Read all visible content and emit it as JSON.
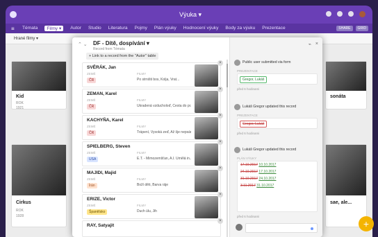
{
  "topbar": {
    "title": "Výuka ▾"
  },
  "navbar": {
    "menu_icon": "menu-icon",
    "tabs": [
      "Témata",
      "Filmy ▾",
      "Autor",
      "Studio",
      "Literatura",
      "Pojmy",
      "Plán výuky",
      "Hodnocení výuky",
      "Body za výuku",
      "Prezentace"
    ],
    "right_pills": [
      "SHARE",
      "GRID"
    ]
  },
  "subbar": {
    "view_label": "Hrané filmy ▾"
  },
  "gallery": {
    "cards": [
      {
        "title": "Kid",
        "meta1": "ROK",
        "meta2": "1921"
      },
      {
        "title": "Cirkus",
        "meta1": "ROK",
        "meta2": "1928"
      },
      {
        "title": "sonáta",
        "meta1": "",
        "meta2": ""
      },
      {
        "title": "sae, ale...",
        "meta1": "",
        "meta2": ""
      }
    ]
  },
  "modal": {
    "title": "DF - Dítě, dospívání ▾",
    "subtitle": "Record from Témata",
    "link_button": "+ Link to a record from the \"Autor\" table",
    "people": [
      {
        "name": "SVĚRÁK, Jan",
        "country": "ČR",
        "films": "Po strništi bos, Kolja, Vrat..."
      },
      {
        "name": "ZEMAN, Karel",
        "country": "ČR",
        "films": "Ukradená vzducholoď, Cesta do pr..."
      },
      {
        "name": "KACHYŇA, Karel",
        "country": "ČR",
        "films": "Trápení, Vysoká zeď, Až šje nepsán..."
      },
      {
        "name": "SPIELBERG, Steven",
        "country": "USA",
        "films": "E.T. - Mimozemšťan, A.I. Umělá in..."
      },
      {
        "name": "MAJIDI, Majid",
        "country": "Írán",
        "films": "Boží děti, Barva ráje"
      },
      {
        "name": "ERIZE, Victor",
        "country": "Španělsko",
        "films": "Duch úlu, Jih"
      },
      {
        "name": "RAY, Satyajit",
        "country": "",
        "films": ""
      }
    ],
    "labels": {
      "country": "ZEMĚ",
      "films": "FILMY"
    }
  },
  "activity": {
    "top_icons": [
      "rss-icon",
      "close-icon"
    ],
    "entries": [
      {
        "line": "Public user submitted via form",
        "field": "PREZENTACE",
        "tags": [
          "Gregor, Lukáš"
        ],
        "time": "před 6 hodinami"
      },
      {
        "line": "Lukáš Gregor updated this record",
        "field": "PREZENTACE",
        "tags": [
          "Gregor, Lukáš"
        ],
        "time": "před 6 hodinami"
      },
      {
        "line": "Lukáš Gregor updated this record",
        "field": "PLÁN VÝUKY",
        "dates": [
          {
            "old": "17.10.2017",
            "new": "10.10.2017"
          },
          {
            "old": "24.10.2017",
            "new": "17.10.2017"
          },
          {
            "old": "31.10.2017",
            "new": "24.10.2017"
          },
          {
            "old": "3.11.2017",
            "new": "31.10.2017"
          }
        ],
        "time": "před 6 hodinami"
      }
    ]
  },
  "colors": {
    "brand": "#6a3fb6",
    "fab": "#f4b400"
  }
}
